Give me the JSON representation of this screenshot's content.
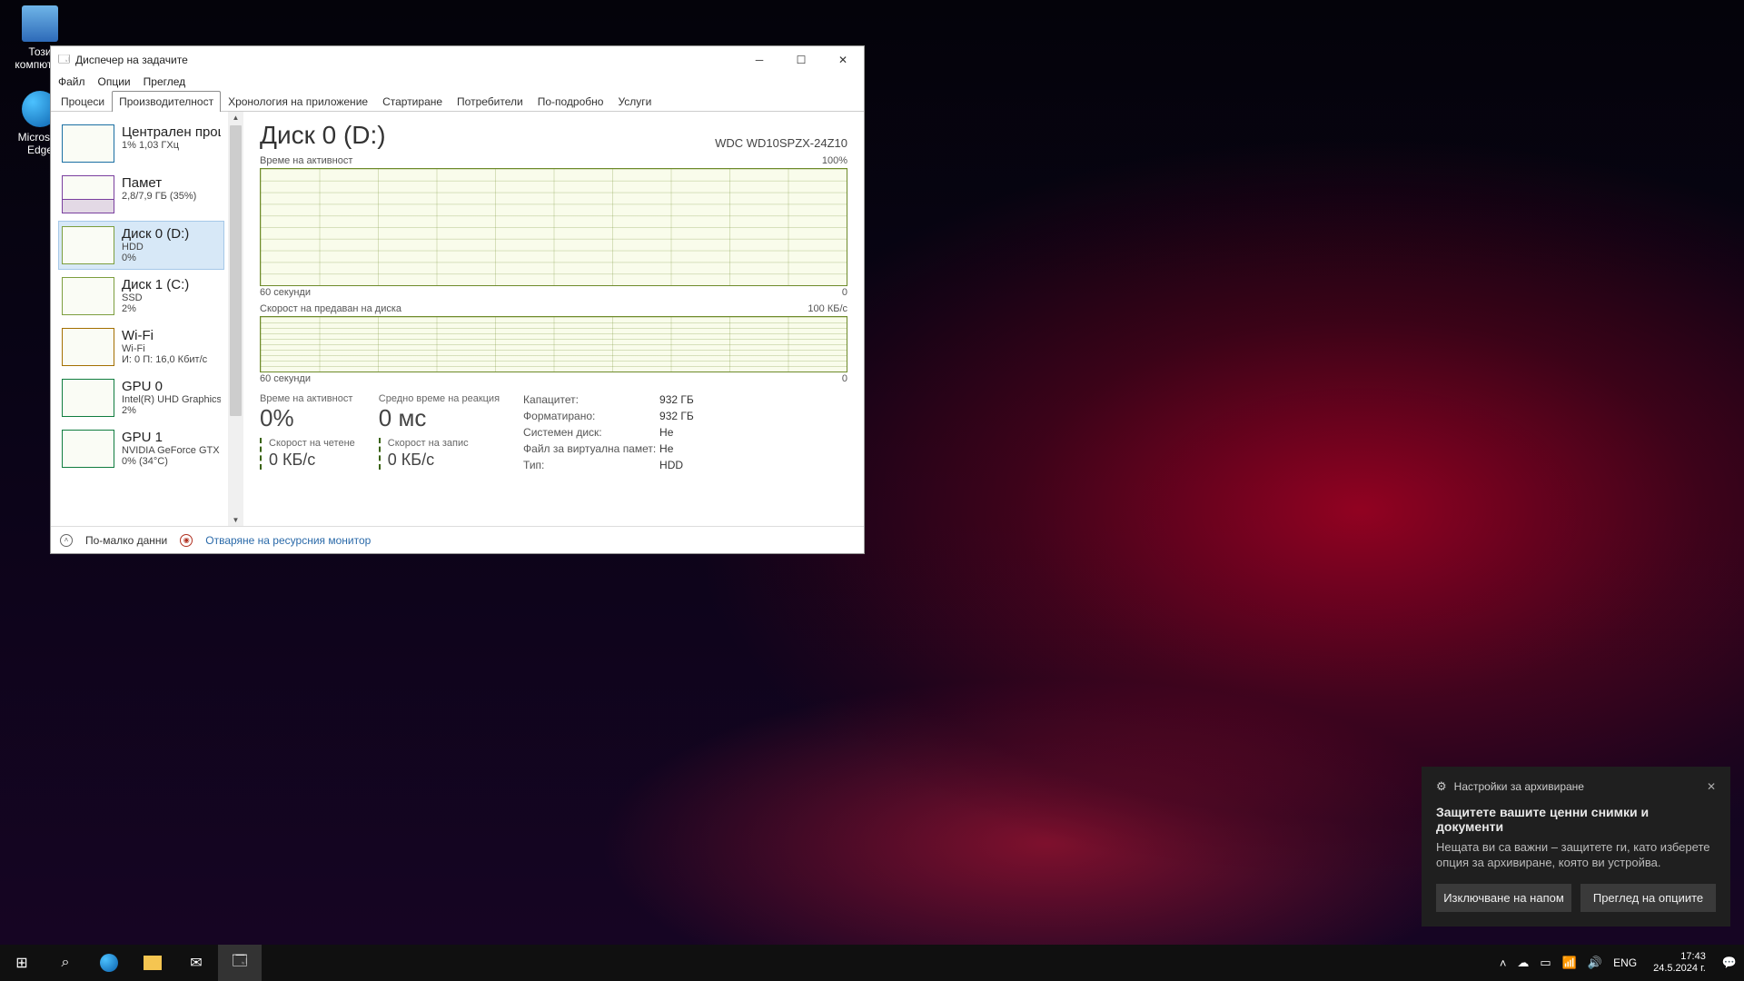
{
  "desktop": {
    "icons": [
      {
        "label": "Този компютър"
      },
      {
        "label": "Microsoft Edge"
      }
    ]
  },
  "window": {
    "title": "Диспечер на задачите",
    "menus": [
      "Файл",
      "Опции",
      "Преглед"
    ],
    "tabs": [
      "Процеси",
      "Производителност",
      "Хронология на приложение",
      "Стартиране",
      "Потребители",
      "По-подробно",
      "Услуги"
    ],
    "active_tab": 1,
    "sidebar": [
      {
        "name": "Централен процесор",
        "sub1": "1% 1,03 ГХц",
        "sub2": ""
      },
      {
        "name": "Памет",
        "sub1": "2,8/7,9 ГБ (35%)",
        "sub2": ""
      },
      {
        "name": "Диск 0 (D:)",
        "sub1": "HDD",
        "sub2": "0%"
      },
      {
        "name": "Диск 1 (C:)",
        "sub1": "SSD",
        "sub2": "2%"
      },
      {
        "name": "Wi-Fi",
        "sub1": "Wi-Fi",
        "sub2": "И: 0 П: 16,0 Кбит/с"
      },
      {
        "name": "GPU 0",
        "sub1": "Intel(R) UHD Graphics",
        "sub2": "2%"
      },
      {
        "name": "GPU 1",
        "sub1": "NVIDIA GeForce GTX",
        "sub2": "0% (34°C)"
      }
    ],
    "selected_sidebar": 2,
    "main": {
      "title": "Диск 0 (D:)",
      "model": "WDC WD10SPZX-24Z10",
      "chart1": {
        "label": "Време на активност",
        "max": "100%",
        "xleft": "60 секунди",
        "xright": "0"
      },
      "chart2": {
        "label": "Скорост на предаван на диска",
        "max": "100 КБ/с",
        "xleft": "60 секунди",
        "xright": "0"
      },
      "stats": {
        "active_label": "Време на активност",
        "active_val": "0%",
        "react_label": "Средно време на реакция",
        "react_val": "0 мс",
        "read_label": "Скорост на четене",
        "read_val": "0 КБ/с",
        "write_label": "Скорост на запис",
        "write_val": "0 КБ/с"
      },
      "kv": [
        {
          "k": "Капацитет:",
          "v": "932 ГБ"
        },
        {
          "k": "Форматирано:",
          "v": "932 ГБ"
        },
        {
          "k": "Системен диск:",
          "v": "Не"
        },
        {
          "k": "Файл за виртуална памет:",
          "v": "Не"
        },
        {
          "k": "Тип:",
          "v": "HDD"
        }
      ]
    },
    "status": {
      "less": "По-малко данни",
      "resmon": "Отваряне на ресурсния монитор"
    }
  },
  "chart_data": [
    {
      "type": "line",
      "title": "Време на активност",
      "ylabel": "%",
      "ylim": [
        0,
        100
      ],
      "x": [
        -60,
        0
      ],
      "values": [
        0,
        0,
        0,
        0,
        0,
        0,
        0,
        0,
        0,
        0,
        0,
        0
      ]
    },
    {
      "type": "line",
      "title": "Скорост на предаван на диска",
      "ylabel": "КБ/с",
      "ylim": [
        0,
        100
      ],
      "x": [
        -60,
        0
      ],
      "values": [
        0,
        0,
        0,
        0,
        0,
        0,
        0,
        0,
        0,
        0,
        0,
        0
      ]
    }
  ],
  "notification": {
    "header": "Настройки за архивиране",
    "title": "Защитете вашите ценни снимки и документи",
    "body": "Нещата ви са важни – защитете ги, като изберете опция за архивиране, която ви устройва.",
    "btn1": "Изключване на напом",
    "btn2": "Преглед на опциите"
  },
  "taskbar": {
    "lang": "ENG",
    "time": "17:43",
    "date": "24.5.2024 г."
  }
}
